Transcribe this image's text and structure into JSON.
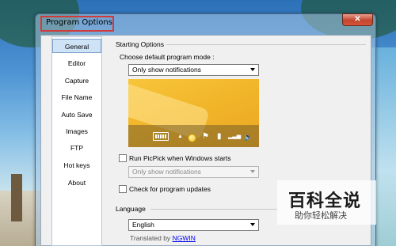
{
  "window": {
    "title": "Program Options",
    "close_glyph": "✕"
  },
  "sidebar": {
    "items": [
      {
        "label": "General",
        "active": true
      },
      {
        "label": "Editor"
      },
      {
        "label": "Capture"
      },
      {
        "label": "File Name"
      },
      {
        "label": "Auto Save"
      },
      {
        "label": "Images"
      },
      {
        "label": "FTP"
      },
      {
        "label": "Hot keys"
      },
      {
        "label": "About"
      }
    ]
  },
  "starting_options": {
    "group_title": "Starting Options",
    "mode_label": "Choose default program mode :",
    "mode_value": "Only show notifications",
    "run_on_start_label": "Run PicPick when Windows starts",
    "run_on_start_checked": false,
    "startup_mode_value": "Only show notifications",
    "check_updates_label": "Check for program updates",
    "check_updates_checked": false
  },
  "language": {
    "group_title": "Language",
    "value": "English",
    "translated_by_prefix": "Translated by",
    "translator": "NGWIN"
  },
  "preview": {
    "tray_icons": [
      "keyboard-icon",
      "up-arrow-icon",
      "chat-icon",
      "flag-icon",
      "network-icon",
      "signal-icon",
      "volume-icon"
    ],
    "up_arrow_glyph": "▲",
    "flag_glyph": "⚑",
    "network_glyph": "▮",
    "signal_glyph": "▂▃▅",
    "volume_glyph": "🔈"
  },
  "watermark": {
    "title": "百科全说",
    "subtitle": "助你轻松解决"
  },
  "colors": {
    "active_tab_bg": "#cfe3f7",
    "highlight_box": "#d23a3a",
    "preview_bg": "#f2b62a",
    "link": "#0000ee"
  }
}
